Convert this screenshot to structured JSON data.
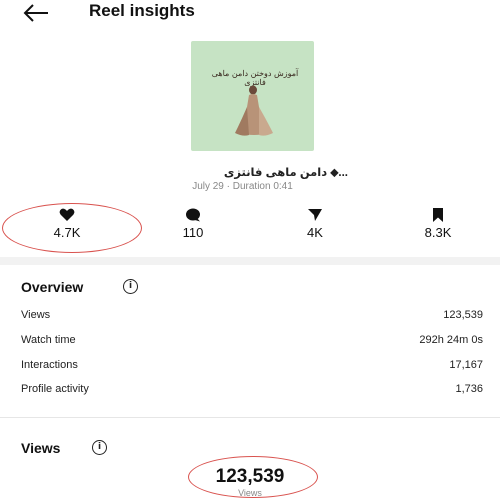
{
  "header": {
    "title": "Reel insights"
  },
  "reel": {
    "thumbnail_text": "آموزش دوختن دامن ماهی فانتزی",
    "name": "دامن ماهی فانتزی ⬥...",
    "meta": "July 29 · Duration 0:41"
  },
  "stats": [
    {
      "icon": "heart-icon",
      "value": "4.7K"
    },
    {
      "icon": "comment-icon",
      "value": "110"
    },
    {
      "icon": "share-icon",
      "value": "4K"
    },
    {
      "icon": "bookmark-icon",
      "value": "8.3K"
    }
  ],
  "overview": {
    "title": "Overview",
    "info_icon": "info-icon",
    "rows": [
      {
        "label": "Views",
        "value": "123,539"
      },
      {
        "label": "Watch time",
        "value": "292h 24m 0s"
      },
      {
        "label": "Interactions",
        "value": "17,167"
      },
      {
        "label": "Profile activity",
        "value": "1,736"
      }
    ]
  },
  "views_section": {
    "title": "Views",
    "info_icon": "info-icon",
    "total": "123,539",
    "caption": "Views"
  },
  "colors": {
    "highlight": "#d9534f",
    "thumbnail_bg": "#c6e3c4",
    "muted_text": "#888888"
  }
}
